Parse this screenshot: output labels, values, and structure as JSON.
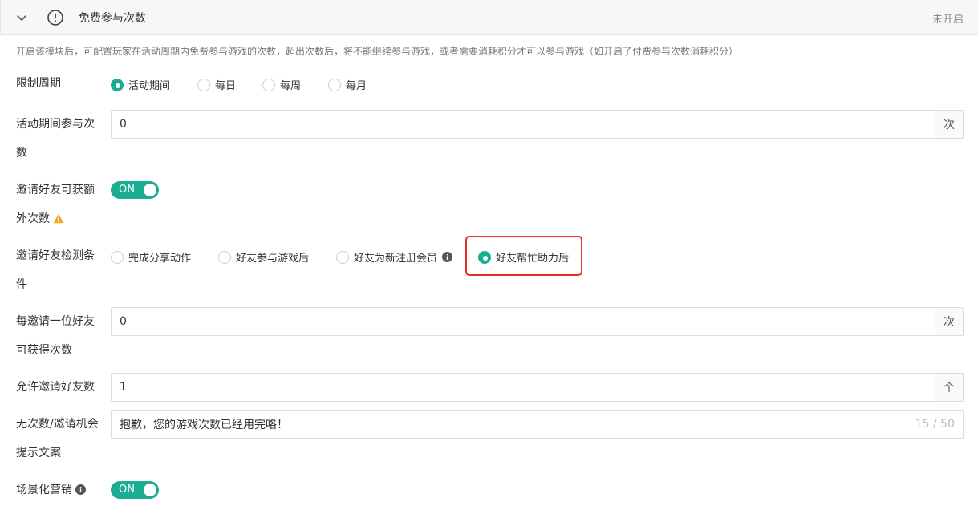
{
  "header": {
    "title": "免费参与次数",
    "status": "未开启"
  },
  "description": "开启该模块后，可配置玩家在活动周期内免费参与游戏的次数，超出次数后，将不能继续参与游戏，或者需要消耗积分才可以参与游戏（如开启了付费参与次数消耗积分）",
  "period": {
    "label": "限制周期",
    "options": [
      "活动期间",
      "每日",
      "每周",
      "每月"
    ],
    "selected": "活动期间"
  },
  "participation": {
    "label_line1": "活动期间参与次",
    "label_line2": "数",
    "value": "0",
    "unit": "次"
  },
  "invite_extra": {
    "label_line1": "邀请好友可获额",
    "label_line2": "外次数",
    "toggle": "ON"
  },
  "invite_condition": {
    "label_line1": "邀请好友检测条",
    "label_line2": "件",
    "options": [
      "完成分享动作",
      "好友参与游戏后",
      "好友为新注册会员",
      "好友帮忙助力后"
    ],
    "selected": "好友帮忙助力后"
  },
  "per_invite": {
    "label_line1": "每邀请一位好友",
    "label_line2": "可获得次数",
    "value": "0",
    "unit": "次"
  },
  "allowed_invites": {
    "label": "允许邀请好友数",
    "value": "1",
    "unit": "个"
  },
  "no_chance_tip": {
    "label_line1": "无次数/邀请机会",
    "label_line2": "提示文案",
    "value": "抱歉，您的游戏次数已经用完咯！",
    "counter": "15 / 50"
  },
  "scene_marketing": {
    "label": "场景化营销",
    "toggle": "ON"
  },
  "colors": {
    "accent": "#1aad91",
    "highlight": "#e8302a",
    "warning": "#f5a623"
  }
}
